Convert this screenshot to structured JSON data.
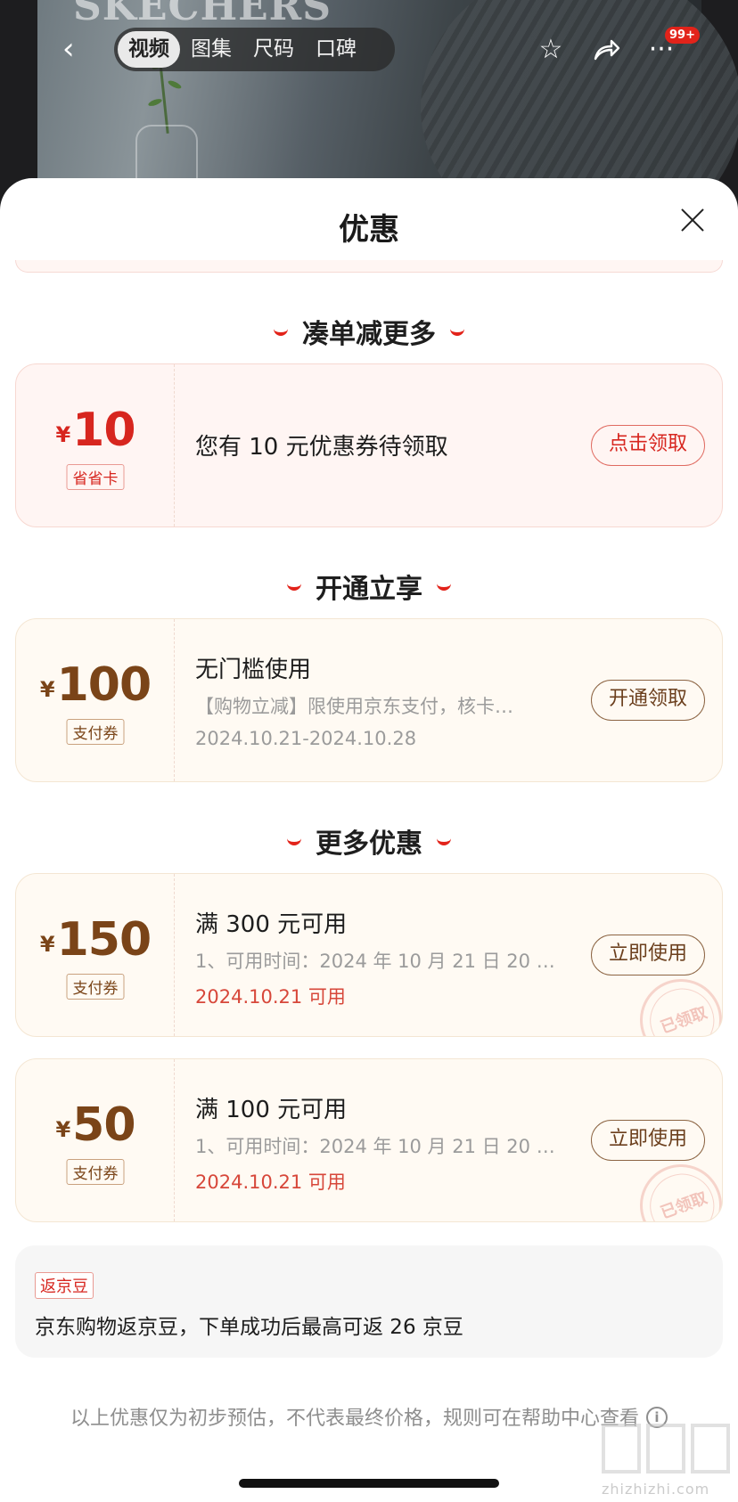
{
  "header": {
    "brand_text": "SKECHERS",
    "tabs": [
      {
        "label": "视频",
        "active": true
      },
      {
        "label": "图集",
        "active": false
      },
      {
        "label": "尺码",
        "active": false
      },
      {
        "label": "口碑",
        "active": false
      }
    ],
    "message_badge": "99+",
    "icons": [
      "back-icon",
      "star-icon",
      "share-icon",
      "more-icon"
    ]
  },
  "sheet": {
    "title": "优惠"
  },
  "sections": {
    "s1": "凑单减更多",
    "s2": "开通立享",
    "s3": "更多优惠"
  },
  "coupons": [
    {
      "currency": "¥",
      "amount": "10",
      "tag": "省省卡",
      "line1": "您有 10 元优惠券待领取",
      "action": "点击领取",
      "style": "pink"
    },
    {
      "currency": "¥",
      "amount": "100",
      "tag": "支付券",
      "line1": "无门槛使用",
      "line2": "【购物立减】限使用京东支付，核卡…",
      "line3": "2024.10.21-2024.10.28",
      "action": "开通领取",
      "style": "cream"
    },
    {
      "currency": "¥",
      "amount": "150",
      "tag": "支付券",
      "line1": "满 300 元可用",
      "line2": "1、可用时间：2024 年 10 月 21 日 20 点…",
      "line3": "2024.10.21 可用",
      "action": "立即使用",
      "stamp": "已领取",
      "style": "cream"
    },
    {
      "currency": "¥",
      "amount": "50",
      "tag": "支付券",
      "line1": "满 100 元可用",
      "line2": "1、可用时间：2024 年 10 月 21 日 20 点…",
      "line3": "2024.10.21 可用",
      "action": "立即使用",
      "stamp": "已领取",
      "style": "cream"
    }
  ],
  "bean": {
    "tag": "返京豆",
    "text": "京东购物返京豆，下单成功后最高可返 26 京豆"
  },
  "disclaimer": "以上优惠仅为初步预估，不代表最终价格，规则可在帮助中心查看",
  "watermark": "zhizhizhi.com",
  "colors": {
    "accent_red": "#e2231a",
    "coupon_brown": "#7a4418",
    "pink_bg": "#fff5f3",
    "cream_bg": "#fffaf3"
  }
}
